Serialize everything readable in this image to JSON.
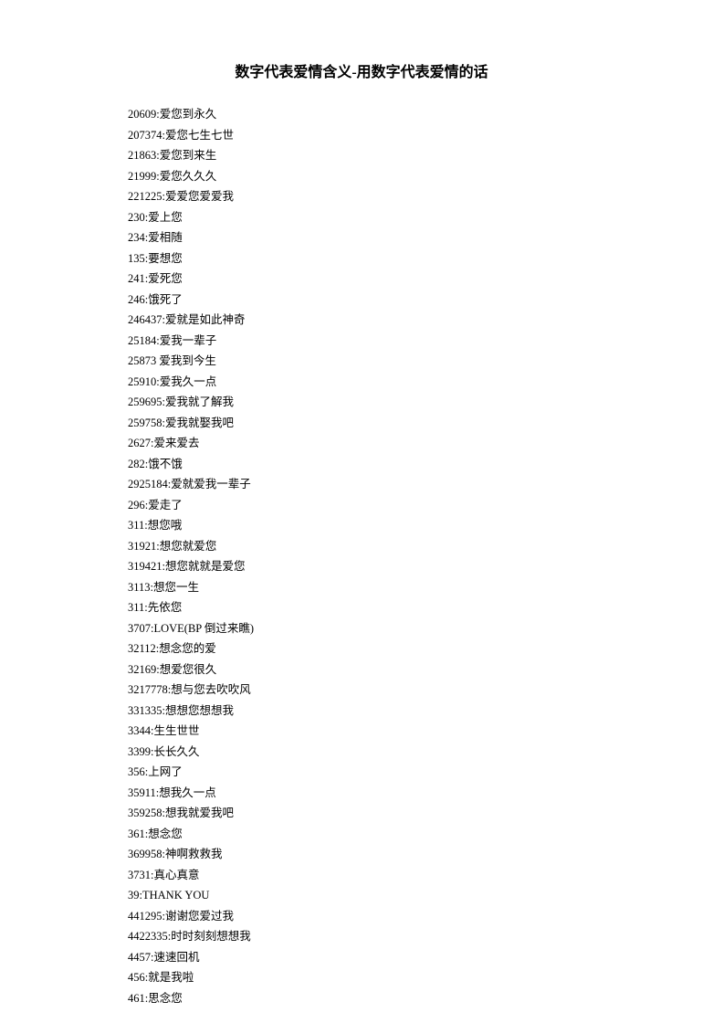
{
  "title": "数字代表爱情含义-用数字代表爱情的话",
  "entries": [
    "20609:爱您到永久",
    "207374:爱您七生七世",
    "21863:爱您到来生",
    "21999:爱您久久久",
    "221225:爱爱您爱爱我",
    "230:爱上您",
    "234:爱相随",
    "135:要想您",
    "241:爱死您",
    "246:饿死了",
    "246437:爱就是如此神奇",
    "25184:爱我一辈子",
    "25873 爱我到今生",
    "25910:爱我久一点",
    "259695:爱我就了解我",
    "259758:爱我就娶我吧",
    "2627:爱来爱去",
    "282:饿不饿",
    "2925184:爱就爱我一辈子",
    "296:爱走了",
    "311:想您哦",
    "31921:想您就爱您",
    "319421:想您就就是爱您",
    "3113:想您一生",
    "311:先依您",
    "3707:LOVE(BP 倒过来瞧)",
    "32112:想念您的爱",
    "32169:想爱您很久",
    "3217778:想与您去吹吹风",
    "331335:想想您想想我",
    "3344:生生世世",
    "3399:长长久久",
    "356:上网了",
    "35911:想我久一点",
    "359258:想我就爱我吧",
    "361:想念您",
    "369958:神啊救救我",
    "3731:真心真意",
    "39:THANK YOU",
    "441295:谢谢您爱过我",
    "4422335:时时刻刻想想我",
    "4457:速速回机",
    "456:就是我啦",
    "461:思念您"
  ]
}
